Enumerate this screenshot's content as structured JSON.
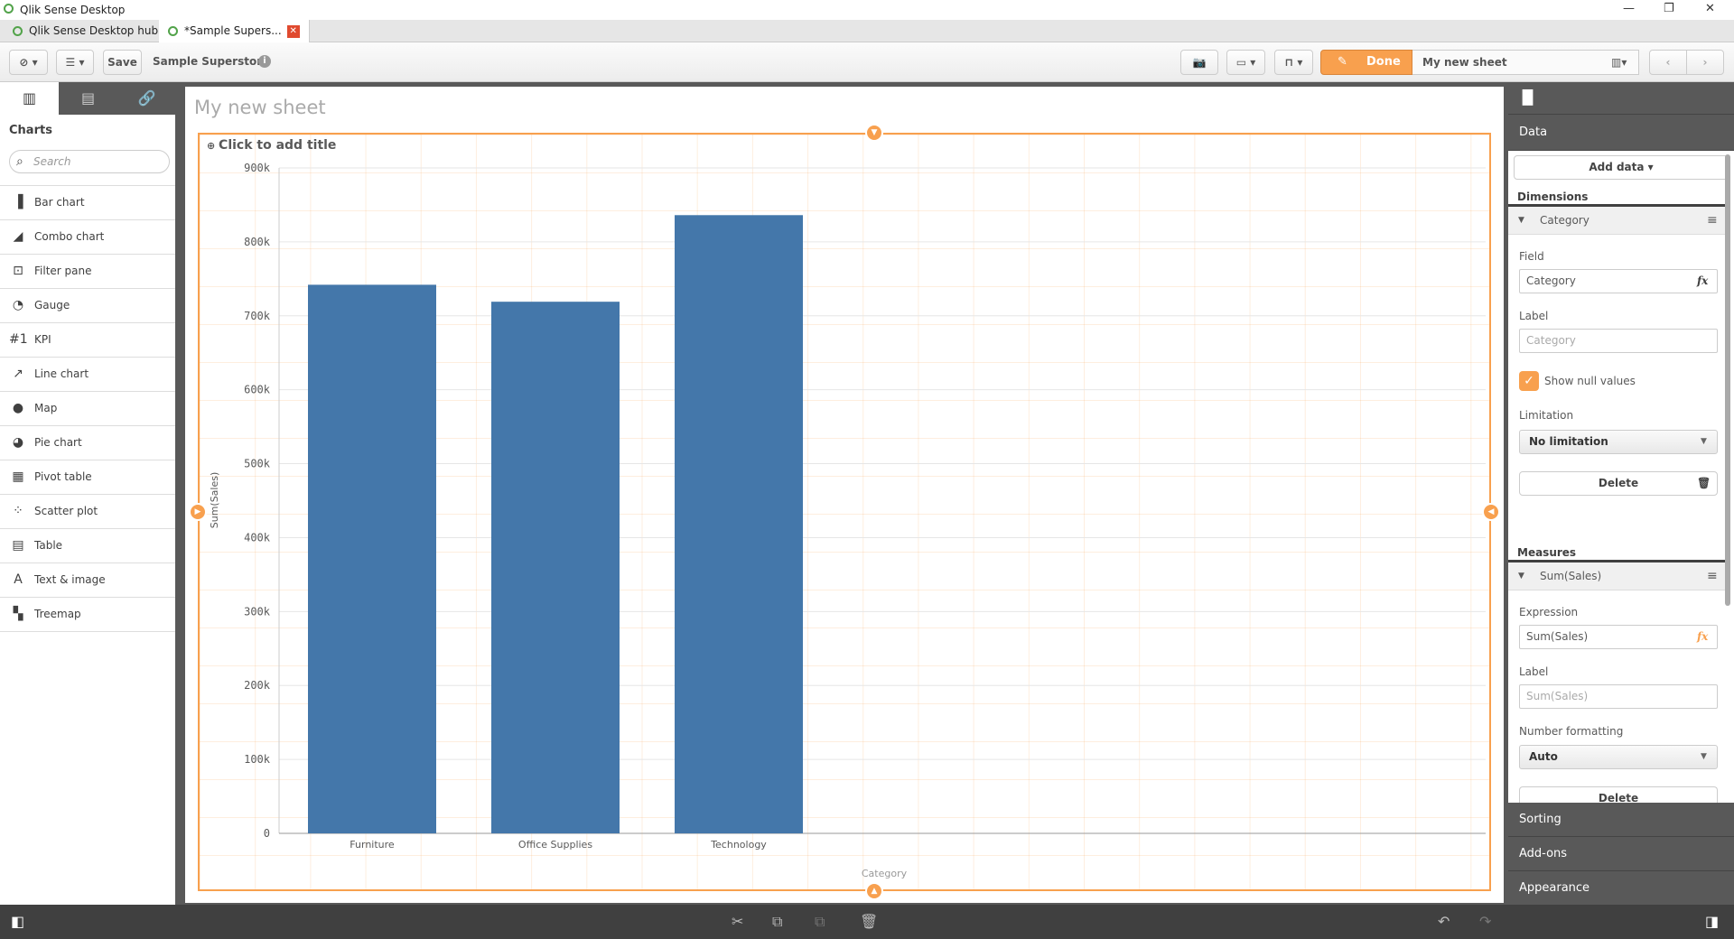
{
  "window": {
    "title": "Qlik Sense Desktop",
    "min": "—",
    "max": "❐",
    "close": "✕"
  },
  "tabs": [
    {
      "label": "Qlik Sense Desktop hub"
    },
    {
      "label": "*Sample Supers...",
      "close": "✕"
    }
  ],
  "toolbar": {
    "save": "Save",
    "app_name": "Sample Superstore",
    "done": "Done",
    "sheet_name": "My new sheet"
  },
  "left": {
    "heading": "Charts",
    "search_placeholder": "Search",
    "items": [
      {
        "label": "Bar chart",
        "icon": "▐"
      },
      {
        "label": "Combo chart",
        "icon": "◢"
      },
      {
        "label": "Filter pane",
        "icon": "⊡"
      },
      {
        "label": "Gauge",
        "icon": "◔"
      },
      {
        "label": "KPI",
        "icon": "#1"
      },
      {
        "label": "Line chart",
        "icon": "↗"
      },
      {
        "label": "Map",
        "icon": "●"
      },
      {
        "label": "Pie chart",
        "icon": "◕"
      },
      {
        "label": "Pivot table",
        "icon": "▦"
      },
      {
        "label": "Scatter plot",
        "icon": "⁘"
      },
      {
        "label": "Table",
        "icon": "▤"
      },
      {
        "label": "Text & image",
        "icon": "A"
      },
      {
        "label": "Treemap",
        "icon": "▚"
      }
    ]
  },
  "sheet": {
    "title": "My new sheet",
    "add_title": "Click to add title"
  },
  "chart_data": {
    "type": "bar",
    "title": "",
    "categories": [
      "Furniture",
      "Office Supplies",
      "Technology"
    ],
    "values": [
      742000,
      719047,
      836154
    ],
    "xlabel": "Category",
    "ylabel": "Sum(Sales)",
    "ylim": [
      0,
      900000
    ],
    "yticks": [
      "0",
      "100k",
      "200k",
      "300k",
      "400k",
      "500k",
      "600k",
      "700k",
      "800k",
      "900k"
    ],
    "bar_color": "#4477aa",
    "grid": true
  },
  "right": {
    "data": "Data",
    "add_data": "Add data ▾",
    "dimensions": "Dimensions",
    "dim_name": "Category",
    "field_label": "Field",
    "field_value": "Category",
    "label_label": "Label",
    "label_placeholder": "Category",
    "show_null": "Show null values",
    "limitation_label": "Limitation",
    "limitation_value": "No limitation",
    "delete": "Delete",
    "measures": "Measures",
    "measure_name": "Sum(Sales)",
    "expression_label": "Expression",
    "expression_value": "Sum(Sales)",
    "mlabel_label": "Label",
    "mlabel_placeholder": "Sum(Sales)",
    "numfmt_label": "Number formatting",
    "numfmt_value": "Auto",
    "sorting": "Sorting",
    "addons": "Add-ons",
    "appearance": "Appearance"
  },
  "colors": {
    "accent": "#f8a04e",
    "dark": "#595959"
  }
}
